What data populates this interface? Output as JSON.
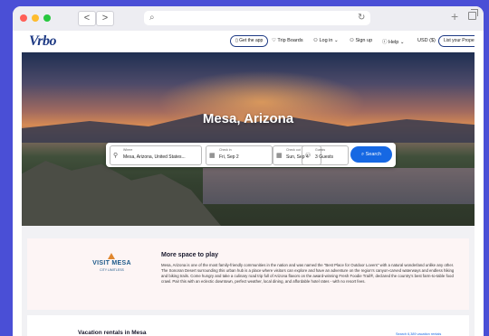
{
  "browser": {
    "back": "<",
    "forward": ">",
    "search_glyph": "⌕",
    "reload_glyph": "↻",
    "new_tab": "+"
  },
  "header": {
    "logo": "Vrbo",
    "get_app": "Get the app",
    "trip_boards": "Trip Boards",
    "log_in": "Log in",
    "sign_up": "Sign up",
    "help": "Help",
    "currency": "USD ($)",
    "list_property": "List your Property"
  },
  "hero": {
    "title": "Mesa, Arizona"
  },
  "search": {
    "where_label": "Where",
    "where_value": "Mesa, Arizona, United States...",
    "checkin_label": "Check in",
    "checkin_value": "Fri, Sep 2",
    "checkout_label": "Check out",
    "checkout_value": "Sun, Sep 4",
    "guests_label": "Guests",
    "guests_value": "3 Guests",
    "button": "Search"
  },
  "promo": {
    "brand_title": "VISIT MESA",
    "brand_sub": "CITY LIMITLESS",
    "title": "More space to play",
    "body": "Mesa, Arizona is one of the most family-friendly communities in the nation and was named the \"Best Place for Outdoor Lovers\" with a natural wonderland unlike any other. The Sonoran Desert surrounding this urban hub is a place where visitors can explore and have an adventure on the region's canyon-carved waterways and endless hiking and biking trails. Come hungry and take a culinary road trip full of Arizona flavors on the award-winning Fresh Foodie Trail®, declared the country's best farm-to-table food crawl. Pair this with an eclectic downtown, perfect weather, local dining, and affordable hotel rates - with no resort fees."
  },
  "rentals": {
    "title": "Vacation rentals in Mesa",
    "link": "Search 6,389 vacation rentals"
  },
  "colors": {
    "brand": "#1e3a84",
    "accent": "#1668e3",
    "background": "#4a4fd6"
  }
}
